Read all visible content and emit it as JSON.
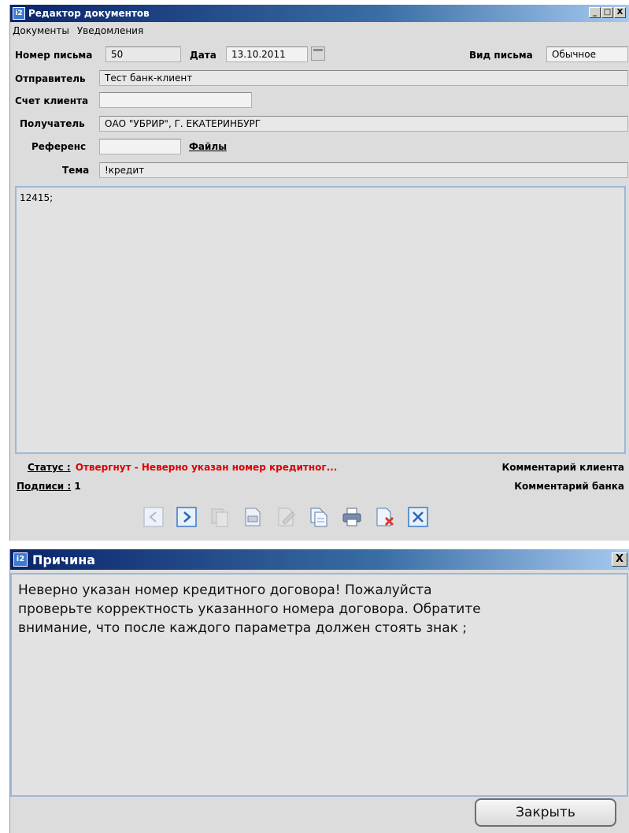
{
  "editor": {
    "title": "Редактор документов",
    "app_icon": "i2",
    "window_buttons": {
      "minimize": "_",
      "maximize": "□",
      "close": "X"
    },
    "menu": [
      "Документы",
      "Уведомления"
    ],
    "fields": {
      "letter_number_label": "Номер письма",
      "letter_number": "50",
      "date_label": "Дата",
      "date": "13.10.2011",
      "letter_type_label": "Вид письма",
      "letter_type": "Обычное",
      "sender_label": "Отправитель",
      "sender": "Тест банк-клиент",
      "account_label": "Счет клиента",
      "account": "",
      "recipient_label": "Получатель",
      "recipient": "ОАО \"УБРИР\", Г. ЕКАТЕРИНБУРГ",
      "reference_label": "Референс",
      "reference": "",
      "files_link": "Файлы",
      "subject_label": "Тема",
      "subject": "!кредит"
    },
    "body_text": "12415;",
    "status_label": "Статус :",
    "status_value": "Отвергнут - Неверно указан номер кредитног...",
    "signatures_label": "Подписи :",
    "signatures_value": "1",
    "client_comment": "Комментарий клиента",
    "bank_comment": "Комментарий банка",
    "toolbar_icons": [
      "prev-icon",
      "next-icon",
      "copy-icon",
      "sign-icon",
      "edit-icon",
      "documents-icon",
      "print-icon",
      "delete-icon",
      "close-icon"
    ]
  },
  "reason": {
    "title": "Причина",
    "app_icon": "i2",
    "close_x": "X",
    "lines": [
      "Неверно указан номер кредитного договора! Пожалуйста",
      "проверьте корректность указанного номера договора. Обратите",
      "внимание, что после каждого параметра должен стоять знак ;"
    ],
    "close_button": "Закрыть"
  },
  "colors": {
    "title_gradient_start": "#0a246a",
    "status_red": "#e00000",
    "text_area_border": "#9cb8d8"
  }
}
